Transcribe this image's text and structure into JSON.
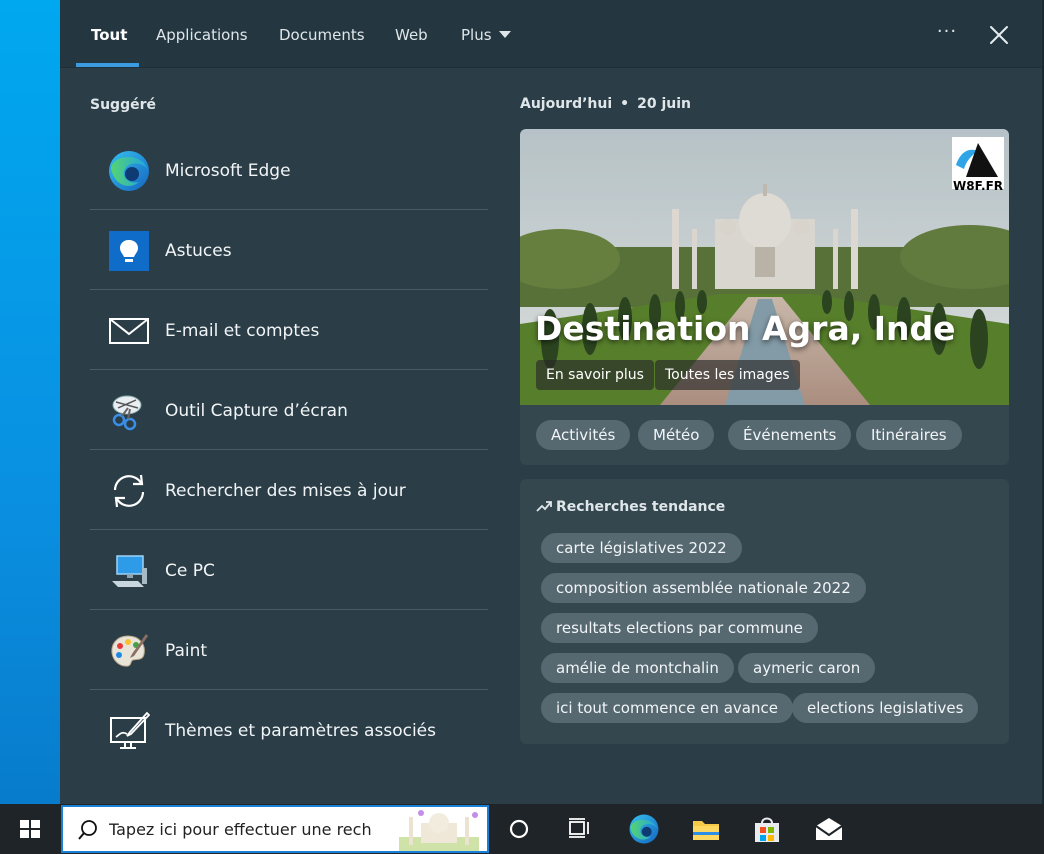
{
  "tabs": [
    {
      "label": "Tout",
      "active": true
    },
    {
      "label": "Applications"
    },
    {
      "label": "Documents"
    },
    {
      "label": "Web"
    },
    {
      "label": "Plus"
    }
  ],
  "more_label": "···",
  "left": {
    "title": "Suggéré",
    "items": [
      {
        "label": "Microsoft Edge",
        "icon": "edge-icon"
      },
      {
        "label": "Astuces",
        "icon": "tips-icon"
      },
      {
        "label": "E-mail et comptes",
        "icon": "mail-icon"
      },
      {
        "label": "Outil Capture d’écran",
        "icon": "snipping-tool-icon"
      },
      {
        "label": "Rechercher des mises à jour",
        "icon": "sync-icon"
      },
      {
        "label": "Ce PC",
        "icon": "computer-icon"
      },
      {
        "label": "Paint",
        "icon": "paint-palette-icon"
      },
      {
        "label": "Thèmes et paramètres associés",
        "icon": "themes-icon"
      }
    ]
  },
  "right": {
    "date_label": "Aujourd’hui",
    "date_value": "20 juin",
    "hero": {
      "title": "Destination Agra, Inde",
      "learn_more": "En savoir plus",
      "all_images": "Toutes les images",
      "watermark": "W8F.FR"
    },
    "hero_chips": [
      "Activités",
      "Météo",
      "Événements",
      "Itinéraires"
    ],
    "trending": {
      "title": "Recherches tendance",
      "items": [
        "carte législatives 2022",
        "composition assemblée nationale 2022",
        "resultats elections par commune",
        "amélie de montchalin",
        "aymeric caron",
        "ici tout commence en avance",
        "elections legislatives"
      ]
    }
  },
  "taskbar": {
    "search_placeholder": "Tapez ici pour effectuer une rech",
    "icons": [
      "windows-start-icon",
      "cortana-icon",
      "task-view-icon",
      "edge-icon",
      "file-explorer-icon",
      "store-icon",
      "mail-icon"
    ]
  },
  "colors": {
    "panel": "#2b3e47",
    "topbar": "#243740",
    "accent": "#3a9be0",
    "chip": "#566870",
    "taskbar": "#1f2428"
  }
}
